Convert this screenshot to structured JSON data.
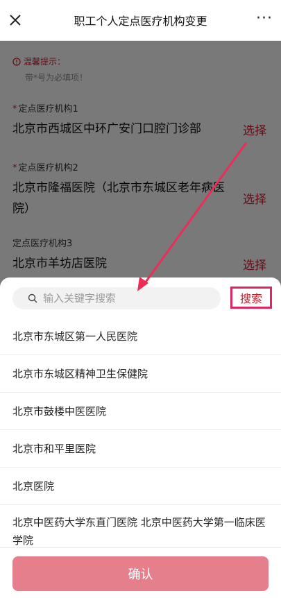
{
  "header": {
    "title": "职工个人定点医疗机构变更",
    "more_label": "···"
  },
  "tips": {
    "title": "温馨提示：",
    "note": "带*号为必填项！"
  },
  "fields": [
    {
      "label": "定点医疗机构1",
      "required": true,
      "value": "北京市西城区中环广安门口腔门诊部",
      "action": "选择"
    },
    {
      "label": "定点医疗机构2",
      "required": true,
      "value": "北京市隆福医院（北京市东城区老年病医院）",
      "action": "选择"
    },
    {
      "label": "定点医疗机构3",
      "required": false,
      "value": "北京市羊坊店医院",
      "action": "选择"
    }
  ],
  "search": {
    "placeholder": "输入关键字搜索",
    "button_label": "搜索"
  },
  "results": [
    "北京市东城区第一人民医院",
    "北京市东城区精神卫生保健院",
    "北京市鼓楼中医医院",
    "北京市和平里医院",
    "北京医院",
    "北京中医药大学东直门医院 北京中医药大学第一临床医学院"
  ],
  "confirm_label": "确认",
  "colors": {
    "accent": "#c71c2c",
    "highlight_border": "#e0245e",
    "confirm_bg": "#e57f8c"
  }
}
